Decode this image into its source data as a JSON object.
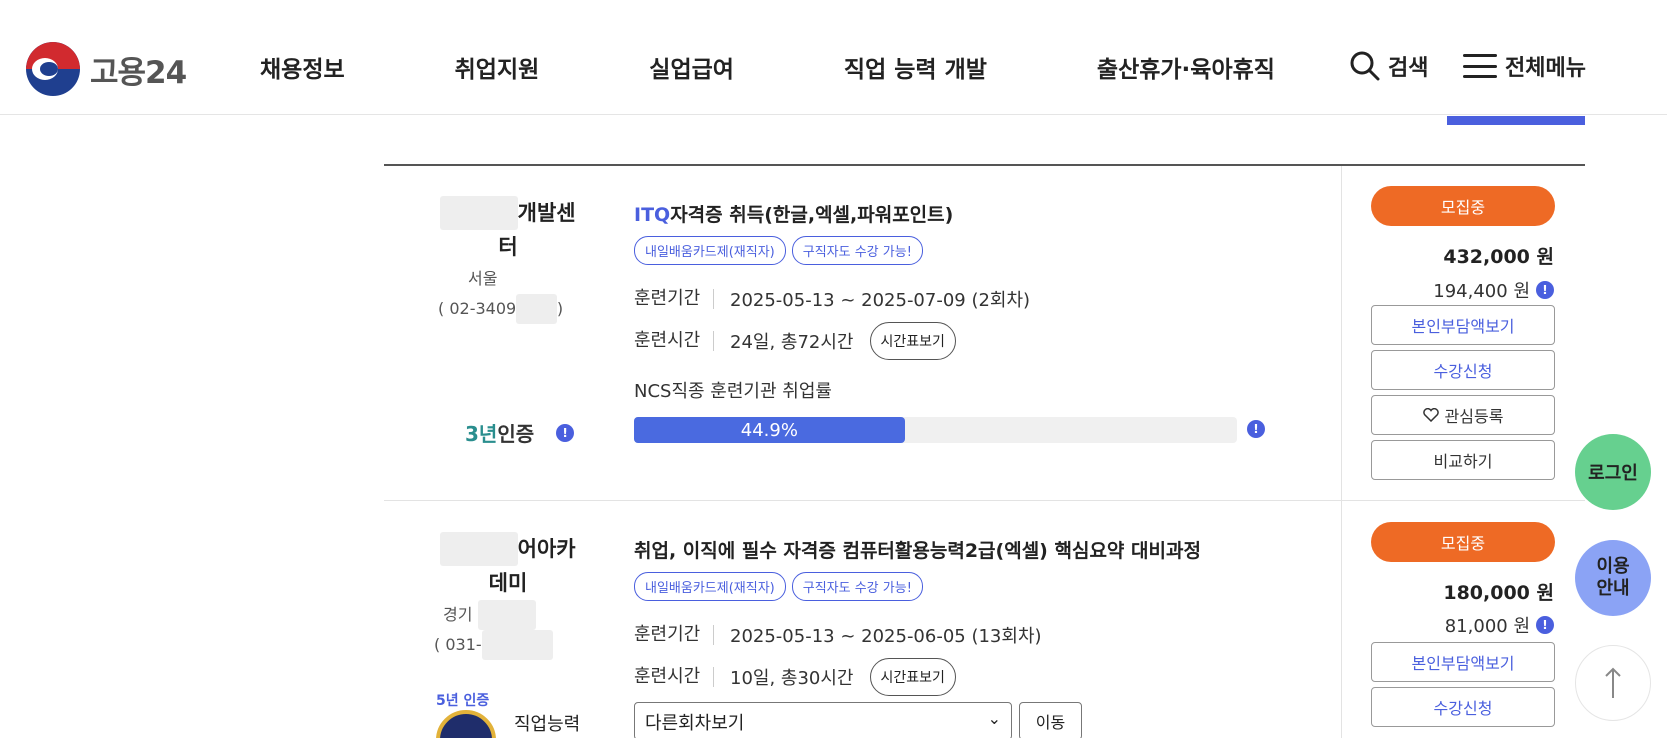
{
  "header": {
    "logo_text": "고용24",
    "nav": [
      "채용정보",
      "취업지원",
      "실업급여",
      "직업 능력 개발",
      "출산휴가·육아휴직"
    ],
    "search_label": "검색",
    "menu_label": "전체메뉴"
  },
  "courses": [
    {
      "org_name_line1": "개발센",
      "org_name_line2": "터",
      "region": "서울",
      "phone": "( 02-3409",
      "phone_end": ")",
      "cert_years": "3년",
      "cert_label": "인증",
      "title_highlight": "ITQ",
      "title": "자격증 취득(한글,엑셀,파워포인트)",
      "tags": [
        "내일배움카드제(재직자)",
        "구직자도 수강 가능!"
      ],
      "period_label": "훈련기간",
      "period_value": "2025-05-13 ~ 2025-07-09 (2회차)",
      "time_label": "훈련시간",
      "time_value": "24일, 총72시간",
      "timetable_btn": "시간표보기",
      "ncs_label": "NCS직종 훈련기관 취업률",
      "employment_rate_text": "44.9%",
      "employment_rate": 44.9,
      "status": "모집중",
      "price": "432,000 원",
      "self_pay": "194,400 원",
      "btn_selfpay": "본인부담액보기",
      "btn_apply": "수강신청",
      "btn_wish": "관심등록",
      "btn_compare": "비교하기"
    },
    {
      "org_name_line1": "어아카",
      "org_name_line2": "데미",
      "region": "경기",
      "phone": "( 031-",
      "title": "취업, 이직에 필수 자격증 컴퓨터활용능력2급(엑셀) 핵심요약 대비과정",
      "tags": [
        "내일배움카드제(재직자)",
        "구직자도 수강 가능!"
      ],
      "period_label": "훈련기간",
      "period_value": "2025-05-13 ~ 2025-06-05 (13회차)",
      "time_label": "훈련시간",
      "time_value": "10일, 총30시간",
      "timetable_btn": "시간표보기",
      "select_value": "다른회차보기",
      "move_btn": "이동",
      "cert_badge": "5년 인증",
      "cert_name": "직업능력",
      "status": "모집중",
      "price": "180,000 원",
      "self_pay": "81,000 원",
      "btn_selfpay": "본인부담액보기",
      "btn_apply": "수강신청"
    }
  ],
  "floating": {
    "login": "로그인",
    "guide_line1": "이용",
    "guide_line2": "안내"
  },
  "colors": {
    "brand_blue": "#4a5fde",
    "status_orange": "#ee6a25",
    "login_green": "#66d08f",
    "guide_blue": "#8ba3f5"
  }
}
